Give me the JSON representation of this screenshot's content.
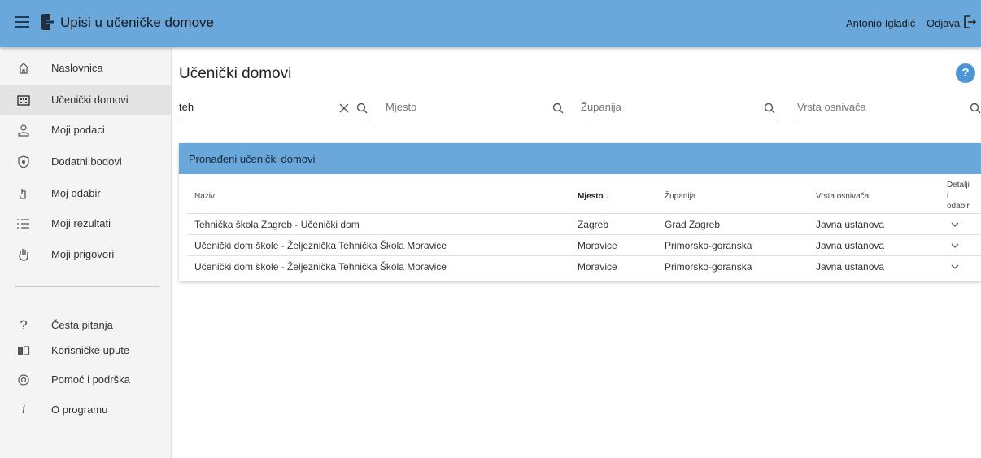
{
  "app": {
    "title": "Upisi u učeničke domove",
    "user": "Antonio Igladić",
    "logout": "Odjava"
  },
  "sidebar": {
    "items": [
      {
        "label": "Naslovnica",
        "icon": "home-icon"
      },
      {
        "label": "Učenički domovi",
        "icon": "building-icon",
        "active": true
      },
      {
        "label": "Moji podaci",
        "icon": "person-icon"
      },
      {
        "label": "Dodatni bodovi",
        "icon": "shield-star-icon"
      },
      {
        "label": "Moj odabir",
        "icon": "hand-pointer-icon"
      },
      {
        "label": "Moji rezultati",
        "icon": "list-numbered-icon"
      },
      {
        "label": "Moji prigovori",
        "icon": "raised-hand-icon"
      }
    ],
    "secondary": [
      {
        "label": "Česta pitanja",
        "icon": "question-icon"
      },
      {
        "label": "Korisničke upute",
        "icon": "book-icon"
      },
      {
        "label": "Pomoć i podrška",
        "icon": "support-icon"
      },
      {
        "label": "O programu",
        "icon": "info-icon"
      }
    ]
  },
  "main": {
    "title": "Učenički domovi",
    "help": "?",
    "filters": {
      "name_value": "teh",
      "place_placeholder": "Mjesto",
      "county_placeholder": "Županija",
      "founder_placeholder": "Vrsta osnivača"
    },
    "panel_title": "Pronađeni učenički domovi",
    "columns": {
      "name": "Naziv",
      "place": "Mjesto ↓",
      "county": "Županija",
      "founder": "Vrsta osnivača",
      "details": [
        "Detalji",
        "i",
        "odabir"
      ]
    },
    "rows": [
      {
        "name": "Tehnička škola Zagreb - Učenički dom",
        "place": "Zagreb",
        "county": "Grad Zagreb",
        "founder": "Javna ustanova"
      },
      {
        "name": "Učenički dom škole - Željeznička Tehnička Škola Moravice",
        "place": "Moravice",
        "county": "Primorsko-goranska",
        "founder": "Javna ustanova"
      },
      {
        "name": "Učenički dom škole - Željeznička Tehnička Škola Moravice",
        "place": "Moravice",
        "county": "Primorsko-goranska",
        "founder": "Javna ustanova"
      }
    ]
  },
  "colors": {
    "header_blue": "#6aa8dc",
    "help_blue": "#4e95d6"
  }
}
